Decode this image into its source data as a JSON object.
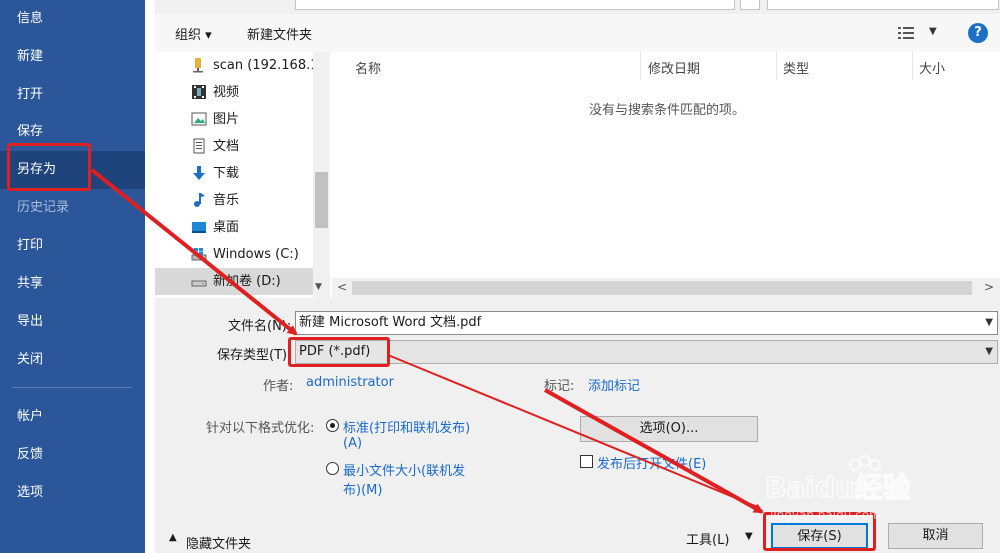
{
  "nav": {
    "items": [
      {
        "label": "信息",
        "state": "normal"
      },
      {
        "label": "新建",
        "state": "normal"
      },
      {
        "label": "打开",
        "state": "normal"
      },
      {
        "label": "保存",
        "state": "normal"
      },
      {
        "label": "另存为",
        "state": "active"
      },
      {
        "label": "历史记录",
        "state": "disabled"
      },
      {
        "label": "打印",
        "state": "normal"
      },
      {
        "label": "共享",
        "state": "normal"
      },
      {
        "label": "导出",
        "state": "normal"
      },
      {
        "label": "关闭",
        "state": "normal"
      },
      {
        "label": "帐户",
        "state": "normal"
      },
      {
        "label": "反馈",
        "state": "normal"
      },
      {
        "label": "选项",
        "state": "normal"
      }
    ]
  },
  "toolbar": {
    "organize_label": "组织 ▾",
    "new_folder_label": "新建文件夹",
    "help_label": "?"
  },
  "tree": {
    "items": [
      {
        "label": "scan (192.168.1",
        "icon": "network-folder-icon"
      },
      {
        "label": "视频",
        "icon": "video-folder-icon"
      },
      {
        "label": "图片",
        "icon": "picture-folder-icon"
      },
      {
        "label": "文档",
        "icon": "document-folder-icon"
      },
      {
        "label": "下载",
        "icon": "download-folder-icon"
      },
      {
        "label": "音乐",
        "icon": "music-folder-icon"
      },
      {
        "label": "桌面",
        "icon": "desktop-folder-icon"
      },
      {
        "label": "Windows (C:)",
        "icon": "windows-drive-icon"
      },
      {
        "label": "新加卷 (D:)",
        "icon": "drive-icon"
      }
    ]
  },
  "list": {
    "columns": [
      "名称",
      "修改日期",
      "类型",
      "大小"
    ],
    "empty_message": "没有与搜索条件匹配的项。"
  },
  "form": {
    "filename_label": "文件名(N):",
    "filename_value": "新建 Microsoft Word 文档.pdf",
    "filetype_label": "保存类型(T):",
    "filetype_value": "PDF (*.pdf)",
    "author_label": "作者:",
    "author_value": "administrator",
    "tags_label": "标记:",
    "tags_value": "添加标记",
    "optimize_label": "针对以下格式优化:",
    "optimize_standard_line1": "标准(打印和联机发布)",
    "optimize_standard_line2": "(A)",
    "optimize_min_line1": "最小文件大小(联机发",
    "optimize_min_line2": "布)(M)",
    "options_button": "选项(O)...",
    "open_after_publish": "发布后打开文件(E)"
  },
  "bottom": {
    "hide_folders": "隐藏文件夹",
    "tools_label": "工具(L)",
    "save_button": "保存(S)",
    "cancel_button": "取消"
  },
  "colors": {
    "nav_bg": "#2b579a",
    "nav_active": "#1f447c",
    "annotation_red": "#e02020",
    "link_blue": "#1b6ac9"
  },
  "watermark": {
    "brand": "Baidu经验",
    "url": "jingyan.baidu.com"
  }
}
